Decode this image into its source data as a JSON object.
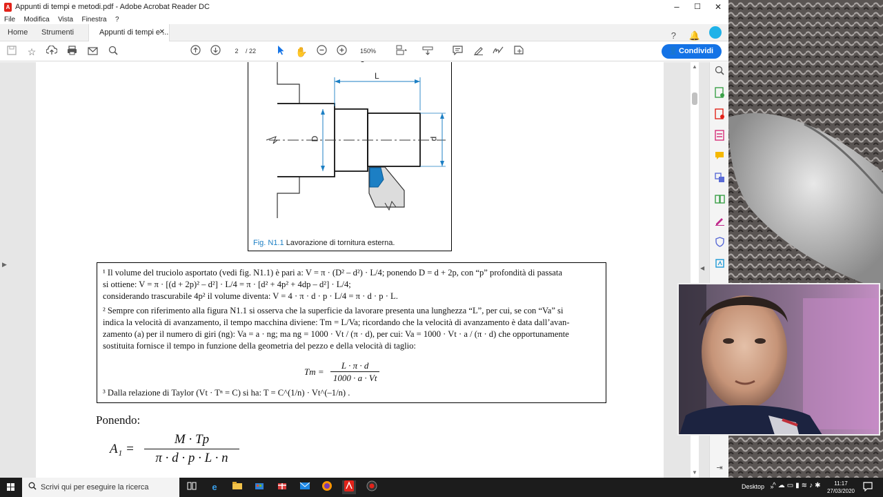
{
  "window": {
    "title": "Appunti di tempi e metodi.pdf - Adobe Acrobat Reader DC",
    "controls": {
      "minimize": "–",
      "maximize": "☐",
      "close": "✕"
    }
  },
  "menu": [
    "File",
    "Modifica",
    "Vista",
    "Finestra",
    "?"
  ],
  "tabs": {
    "home": "Home",
    "tools": "Strumenti",
    "document": "Appunti di tempi e ...",
    "close": "✕"
  },
  "toolbar": {
    "page_current": "2",
    "page_total": "/  22",
    "zoom": "150%",
    "share_label": "Condividi"
  },
  "figure": {
    "label_L": "L",
    "label_D": "D",
    "label_d": "d",
    "caption_num": "Fig. N1.1",
    "caption_text": "Lavorazione di tornitura esterna."
  },
  "notes": {
    "n1_line1": "¹ Il volume del truciolo asportato (vedi fig. N1.1) è pari a: V = π · (D² – d²) · L/4; ponendo D = d + 2p, con “p” profondità di passata",
    "n1_line2": "si ottiene: V = π · [(d + 2p)² – d²] · L/4 = π · [d² + 4p² + 4dp – d²] · L/4;",
    "n1_line3": "considerando trascurabile 4p² il volume diventa: V = 4 · π · d · p · L/4 = π · d · p · L.",
    "n2_line1": "² Sempre con riferimento alla figura N1.1 si osserva che la superficie da lavorare presenta una lunghezza “L”, per cui, se con “Va” si",
    "n2_line2": "indica la velocità di avanzamento, il tempo macchina diviene: Tm = L/Va; ricordando che la velocità di avanzamento è data dall’avan-",
    "n2_line3": "zamento (a) per il numero di giri (ng): Va = a · ng; ma ng = 1000 · Vt / (π · d), per cui: Va = 1000 · Vt · a / (π · d) che opportunamente",
    "n2_line4": "sostituita fornisce il tempo in funzione della geometria del pezzo e della velocità di taglio:",
    "tm_lhs": "Tm =",
    "tm_num": "L · π · d",
    "tm_den": "1000 · a · Vt",
    "n3": "³ Dalla relazione di Taylor (Vt · Tⁿ = C) si ha: T = C^(1/n) · Vt^(–1/n) ."
  },
  "body": {
    "ponendo": "Ponendo:",
    "a1_lhs": "A₁ =",
    "a1_num": "M · Tp",
    "a1_den": "π · d · p · L · n"
  },
  "taskbar": {
    "search_placeholder": "Scrivi qui per eseguire la ricerca",
    "desktop_label": "Desktop",
    "time": "11:17",
    "date": "27/03/2020"
  },
  "colors": {
    "accent": "#1473e6",
    "acrobat_red": "#e2231a",
    "taskbar": "#1c1c1c"
  }
}
